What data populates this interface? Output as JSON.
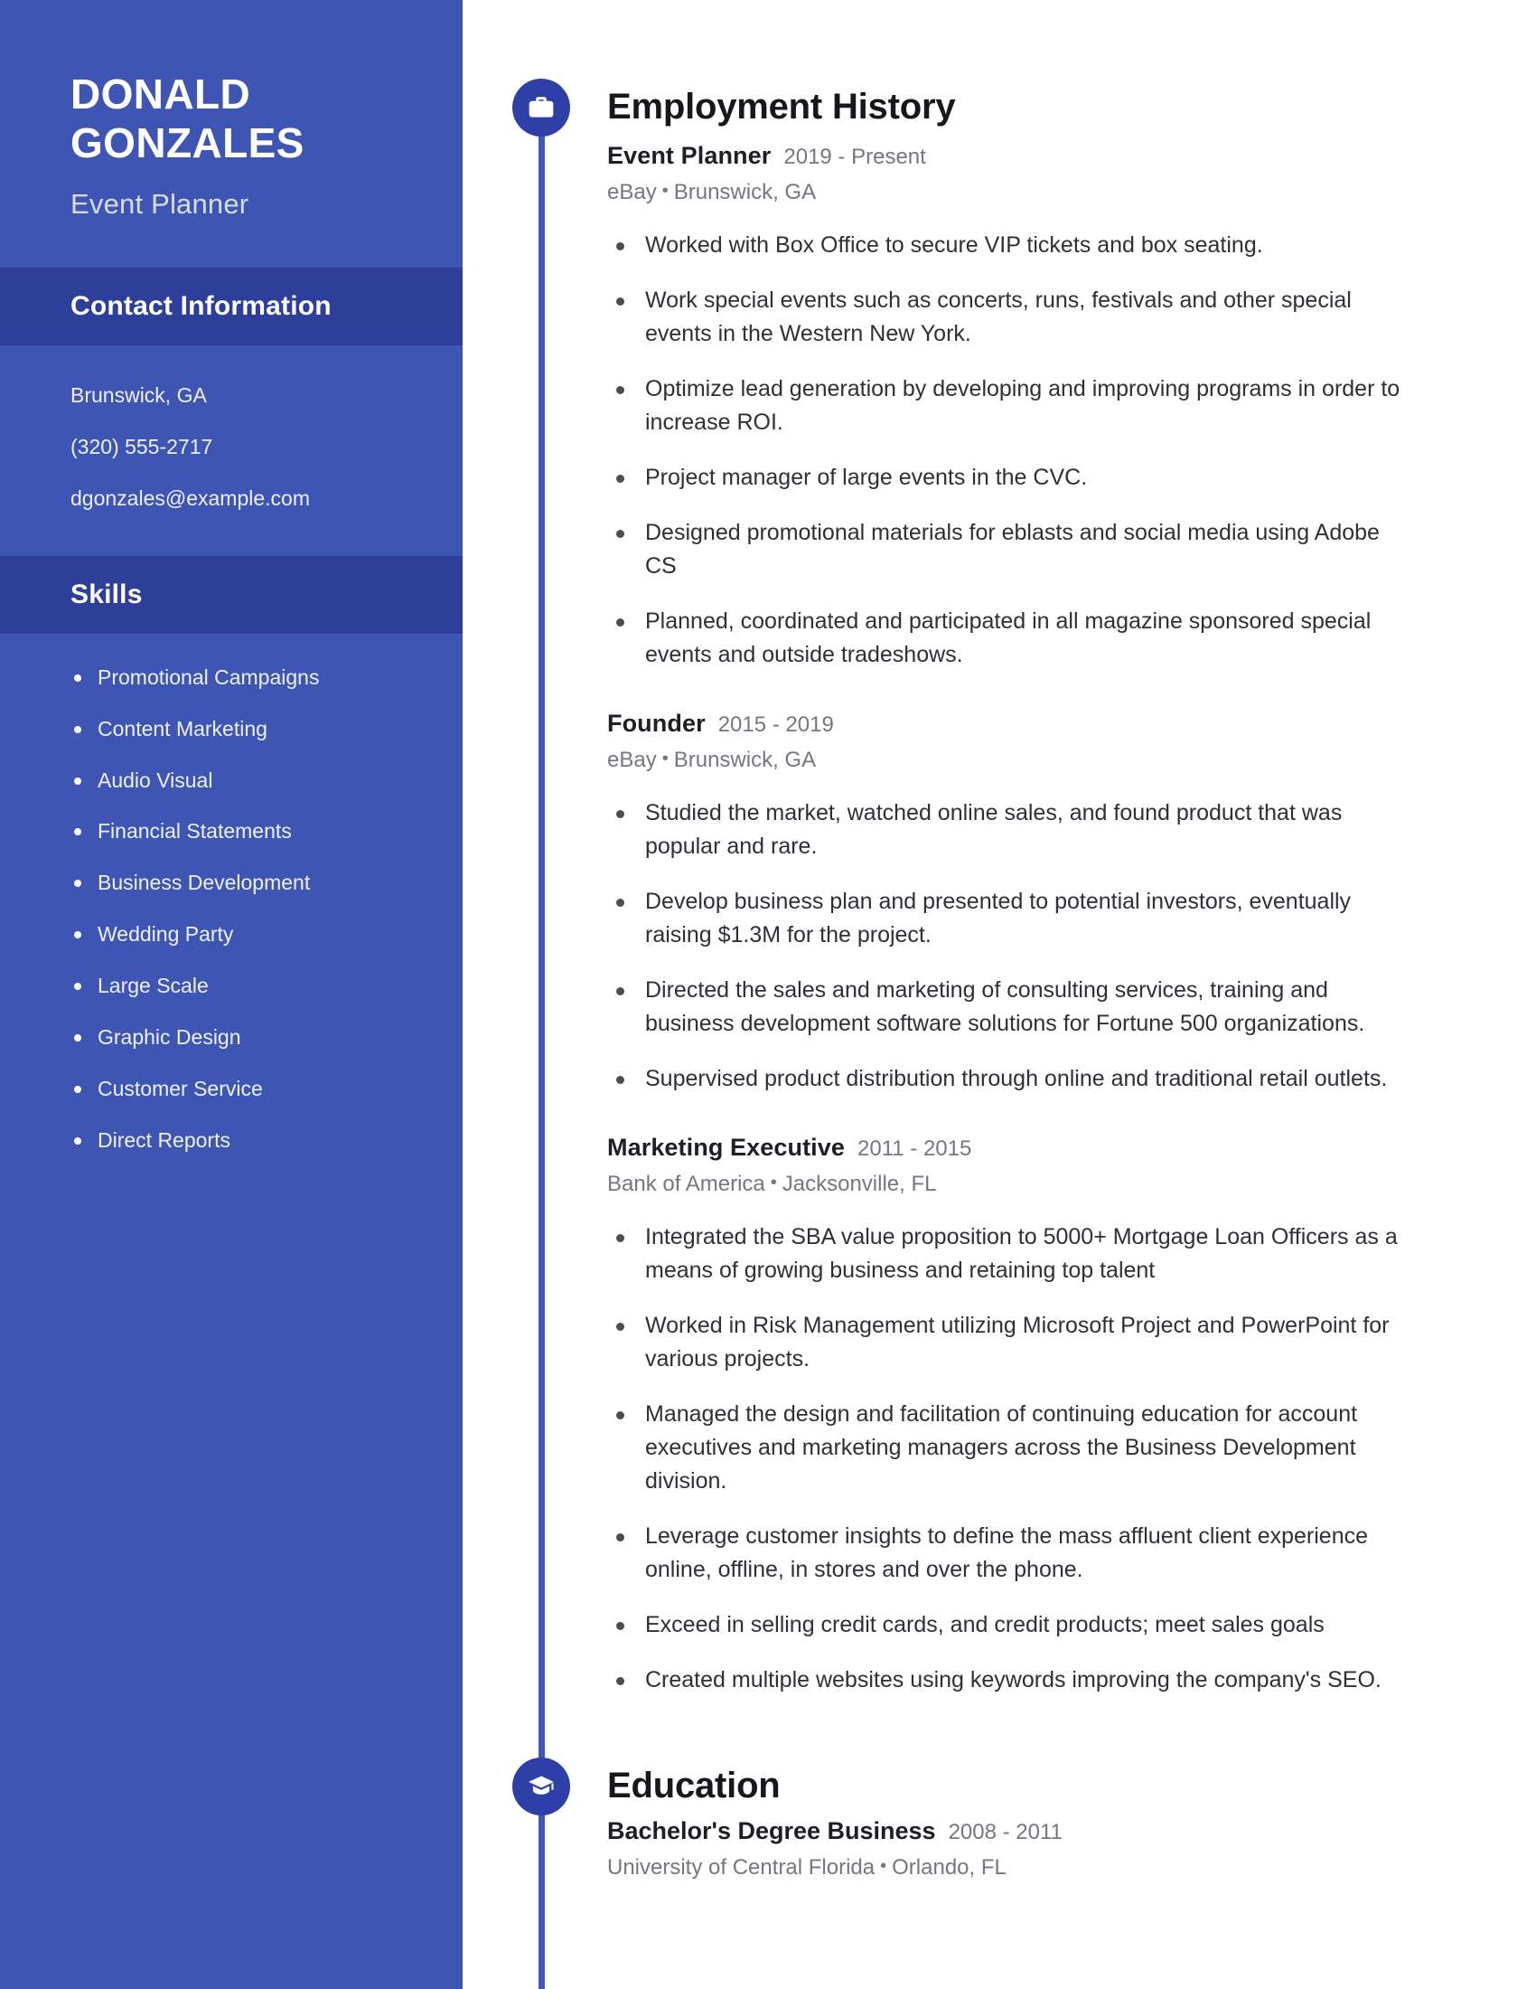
{
  "colors": {
    "sidebar_bg": "#3f55b4",
    "sidebar_band_bg": "#2e3f9a",
    "marker_bg": "#2f3fa8",
    "spine": "#4255c0",
    "body_text": "#2e3036",
    "muted_text": "#74777f"
  },
  "sidebar": {
    "name": "DONALD GONZALES",
    "role": "Event Planner",
    "contact_heading": "Contact Information",
    "contact": [
      "Brunswick, GA",
      "(320) 555-2717",
      "dgonzales@example.com"
    ],
    "skills_heading": "Skills",
    "skills": [
      "Promotional Campaigns",
      "Content Marketing",
      "Audio Visual",
      "Financial Statements",
      "Business Development",
      "Wedding Party",
      "Large Scale",
      "Graphic Design",
      "Customer Service",
      "Direct Reports"
    ]
  },
  "employment": {
    "heading": "Employment History",
    "icon": "briefcase-icon",
    "jobs": [
      {
        "title": "Event Planner",
        "dates": "2019 - Present",
        "company": "eBay",
        "location": "Brunswick, GA",
        "bullets": [
          "Worked with Box Office to secure VIP tickets and box seating.",
          "Work special events such as concerts, runs, festivals and other special events in the Western New York.",
          "Optimize lead generation by developing and improving programs in order to increase ROI.",
          "Project manager of large events in the CVC.",
          "Designed promotional materials for eblasts and social media using Adobe CS",
          "Planned, coordinated and participated in all magazine sponsored special events and outside tradeshows."
        ]
      },
      {
        "title": "Founder",
        "dates": "2015 - 2019",
        "company": "eBay",
        "location": "Brunswick, GA",
        "bullets": [
          "Studied the market, watched online sales, and found product that was popular and rare.",
          "Develop business plan and presented to potential investors, eventually raising $1.3M for the project.",
          "Directed the sales and marketing of consulting services, training and business development software solutions for Fortune 500 organizations.",
          "Supervised product distribution through online and traditional retail outlets."
        ]
      },
      {
        "title": "Marketing Executive",
        "dates": "2011 - 2015",
        "company": "Bank of America",
        "location": "Jacksonville, FL",
        "bullets": [
          "Integrated the SBA value proposition to 5000+ Mortgage Loan Officers as a means of growing business and retaining top talent",
          "Worked in Risk Management utilizing Microsoft Project and PowerPoint for various projects.",
          "Managed the design and facilitation of continuing education for account executives and marketing managers across the Business Development division.",
          "Leverage customer insights to define the mass affluent client experience online, offline, in stores and over the phone.",
          "Exceed in selling credit cards, and credit products; meet sales goals",
          "Created multiple websites using keywords improving the company's SEO."
        ]
      }
    ]
  },
  "education": {
    "heading": "Education",
    "icon": "graduation-cap-icon",
    "entries": [
      {
        "degree": "Bachelor's Degree Business",
        "dates": "2008 - 2011",
        "school": "University of Central Florida",
        "location": "Orlando, FL"
      }
    ]
  },
  "separator": "•"
}
